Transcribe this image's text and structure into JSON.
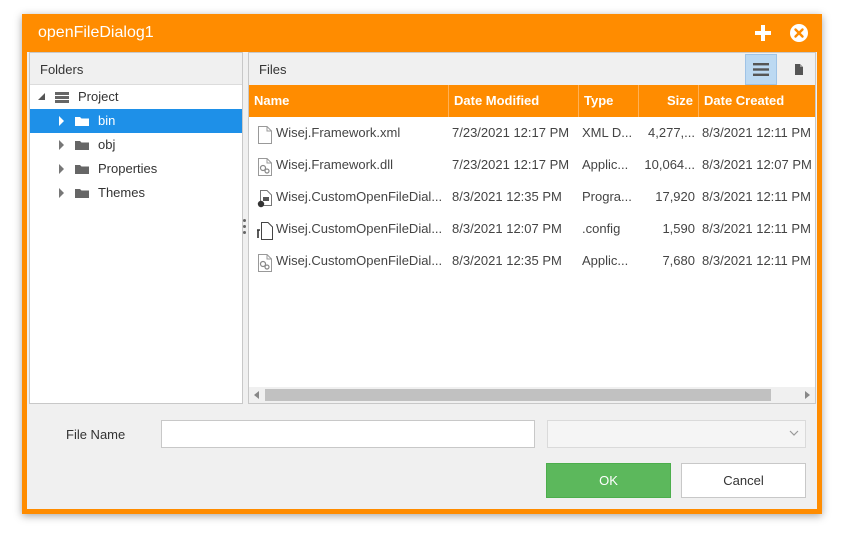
{
  "window": {
    "title": "openFileDialog1"
  },
  "folders": {
    "header": "Folders",
    "tree": [
      {
        "label": "Project",
        "level": 0,
        "expanded": true,
        "icon": "database-icon",
        "selected": false
      },
      {
        "label": "bin",
        "level": 1,
        "expanded": false,
        "icon": "folder-icon",
        "selected": true
      },
      {
        "label": "obj",
        "level": 1,
        "expanded": false,
        "icon": "folder-icon",
        "selected": false
      },
      {
        "label": "Properties",
        "level": 1,
        "expanded": false,
        "icon": "folder-icon",
        "selected": false
      },
      {
        "label": "Themes",
        "level": 1,
        "expanded": false,
        "icon": "folder-icon",
        "selected": false
      }
    ]
  },
  "files": {
    "header": "Files",
    "columns": [
      "Name",
      "Date Modified",
      "Type",
      "Size",
      "Date Created"
    ],
    "rows": [
      {
        "icon": "document-icon",
        "name": "Wisej.Framework.xml",
        "modified": "7/23/2021 12:17 PM",
        "type": "XML D...",
        "size": "4,277,...",
        "created": "8/3/2021 12:11 PM"
      },
      {
        "icon": "dll-icon",
        "name": "Wisej.Framework.dll",
        "modified": "7/23/2021 12:17 PM",
        "type": "Applic...",
        "size": "10,064...",
        "created": "8/3/2021 12:07 PM"
      },
      {
        "icon": "program-icon",
        "name": "Wisej.CustomOpenFileDial...",
        "modified": "8/3/2021 12:35 PM",
        "type": "Progra...",
        "size": "17,920",
        "created": "8/3/2021 12:11 PM"
      },
      {
        "icon": "config-icon",
        "name": "Wisej.CustomOpenFileDial...",
        "modified": "8/3/2021 12:07 PM",
        "type": ".config",
        "size": "1,590",
        "created": "8/3/2021 12:11 PM"
      },
      {
        "icon": "dll-icon",
        "name": "Wisej.CustomOpenFileDial...",
        "modified": "8/3/2021 12:35 PM",
        "type": "Applic...",
        "size": "7,680",
        "created": "8/3/2021 12:11 PM"
      }
    ]
  },
  "bottom": {
    "file_name_label": "File Name",
    "file_name_value": "",
    "filter_value": "",
    "ok_label": "OK",
    "cancel_label": "Cancel"
  },
  "colors": {
    "accent": "#ff8c00",
    "selection": "#1e90e8",
    "ok": "#5cb85c"
  }
}
